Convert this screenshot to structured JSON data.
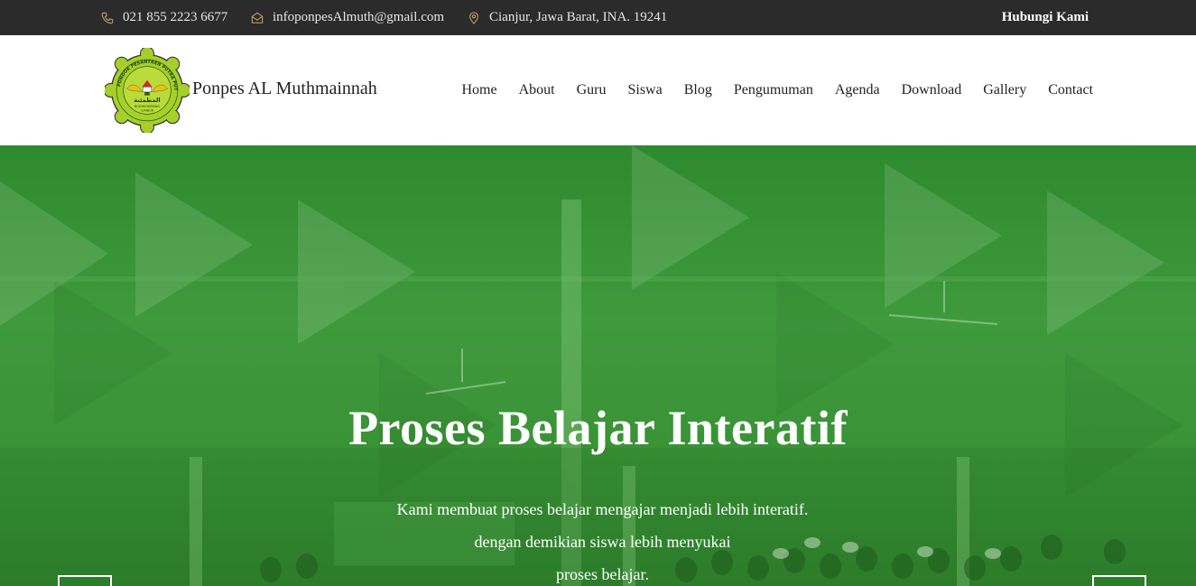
{
  "topbar": {
    "phone": "021 855 2223 6677",
    "email": "infoponpesAlmuth@gmail.com",
    "address": "Cianjur, Jawa Barat, INA. 19241",
    "cta": "Hubungi Kami",
    "icon_color": "#c9a16a"
  },
  "header": {
    "brand": "Ponpes AL Muthmainnah",
    "nav": [
      "Home",
      "About",
      "Guru",
      "Siswa",
      "Blog",
      "Pengumuman",
      "Agenda",
      "Download",
      "Gallery",
      "Contact"
    ],
    "logo": {
      "ring_text": "PONDOK PESANTREN PUTRA PUTRI",
      "arabic": "المطمئنة",
      "sub1": "BOJONGHERANG",
      "sub2": "CIANJUR",
      "color": "#a6cf2a"
    }
  },
  "hero": {
    "title": "Proses Belajar Interatif",
    "lines": [
      "Kami membuat proses belajar mengajar menjadi lebih interatif.",
      "dengan demikian siswa lebih menyukai",
      "proses belajar."
    ],
    "overlay_color": "#2e8a2e"
  }
}
